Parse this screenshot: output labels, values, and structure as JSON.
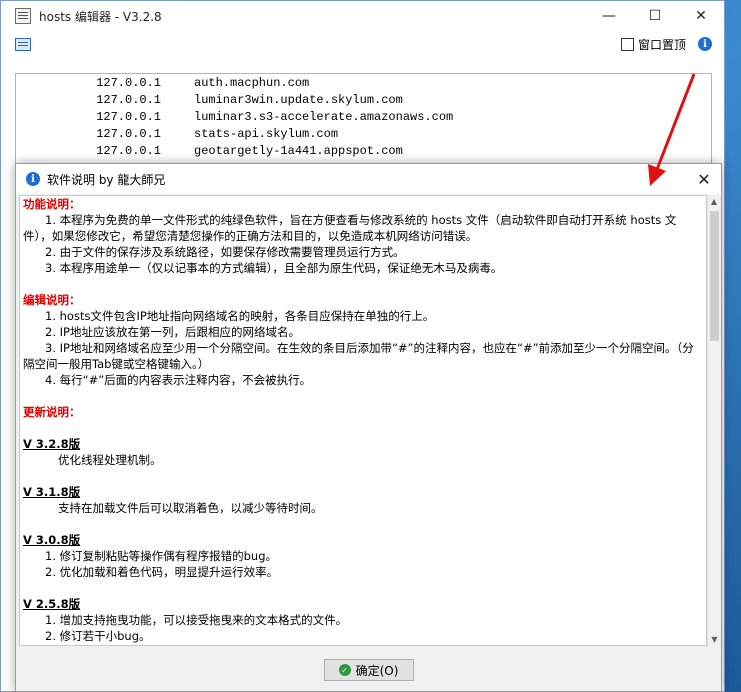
{
  "window": {
    "title": "hosts 编辑器 - V3.2.8",
    "minimize": "—",
    "maximize": "☐",
    "close": "✕"
  },
  "toolbar": {
    "topmost_label": "窗口置顶",
    "info_glyph": "i"
  },
  "hosts": [
    {
      "ip": "127.0.0.1",
      "host": "auth.macphun.com"
    },
    {
      "ip": "127.0.0.1",
      "host": "luminar3win.update.skylum.com"
    },
    {
      "ip": "127.0.0.1",
      "host": "luminar3.s3-accelerate.amazonaws.com"
    },
    {
      "ip": "127.0.0.1",
      "host": "stats-api.skylum.com"
    },
    {
      "ip": "127.0.0.1",
      "host": "geotargetly-1a441.appspot.com"
    }
  ],
  "dialog": {
    "title": "软件说明 by 龍大師兄",
    "info_glyph": "i",
    "close": "✕",
    "sec1_title": "功能说明：",
    "sec1_l1": "1. 本程序为免费的单一文件形式的纯绿色软件，旨在方便查看与修改系统的 hosts 文件（启动软件即自动打开系统 hosts 文件），如果您修改它，希望您清楚您操作的正确方法和目的，以免造成本机网络访问错误。",
    "sec1_l2": "2. 由于文件的保存涉及系统路径，如要保存修改需要管理员运行方式。",
    "sec1_l3": "3. 本程序用途单一（仅以记事本的方式编辑），且全部为原生代码，保证绝无木马及病毒。",
    "sec2_title": "编辑说明：",
    "sec2_l1": "1. hosts文件包含IP地址指向网络域名的映射，各条目应保持在单独的行上。",
    "sec2_l2": "2. IP地址应该放在第一列，后跟相应的网络域名。",
    "sec2_l3": "3. IP地址和网络域名应至少用一个分隔空间。在生效的条目后添加带“#”的注释内容，也应在“#”前添加至少一个分隔空间。（分隔空间一般用Tab键或空格键输入。）",
    "sec2_l4": "4. 每行“#”后面的内容表示注释内容，不会被执行。",
    "sec3_title": "更新说明：",
    "v1": "V 3.2.8版",
    "v1_l1": "优化线程处理机制。",
    "v2": "V 3.1.8版",
    "v2_l1": "支持在加载文件后可以取消着色，以减少等待时间。",
    "v3": "V 3.0.8版",
    "v3_l1": "1. 修订复制粘贴等操作偶有程序报错的bug。",
    "v3_l2": "2. 优化加载和着色代码，明显提升运行效率。",
    "v4": "V 2.5.8版",
    "v4_l1": "1. 增加支持拖曳功能，可以接受拖曳来的文本格式的文件。",
    "v4_l2": "2. 修订若干小bug。",
    "ok_label": "确定(O)",
    "ok_glyph": "✓"
  },
  "colors": {
    "heading": "#e00000",
    "arrow": "#e01010",
    "info": "#1f6ecf"
  }
}
